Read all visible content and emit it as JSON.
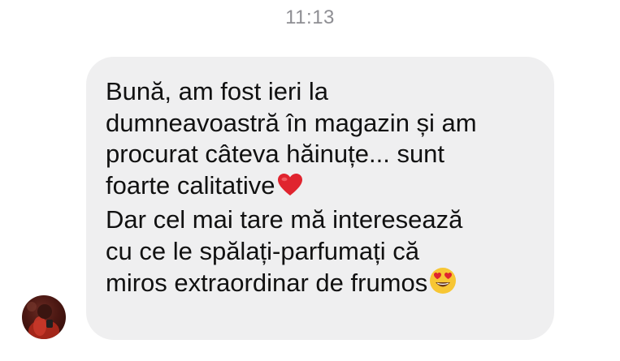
{
  "conversation": {
    "timestamp": "11:13",
    "message": {
      "lines": [
        "Bună, am fost ieri la",
        "dumneavoastră în magazin și am",
        "procurat câteva hăinuțe... sunt",
        "foarte calitative",
        "Dar cel mai tare mă interesează",
        "cu ce le spălați-parfumați că",
        "miros extraordinar de frumos"
      ],
      "emojis": {
        "line_4": "red-heart-emoji",
        "line_7": "heart-eyes-emoji"
      }
    },
    "sender_avatar": "avatar-photo"
  },
  "colors": {
    "bubble_bg": "#efeff0",
    "timestamp": "#8e8e93",
    "text": "#111111",
    "heart": "#e0242f",
    "emoji_face": "#f7c634"
  }
}
